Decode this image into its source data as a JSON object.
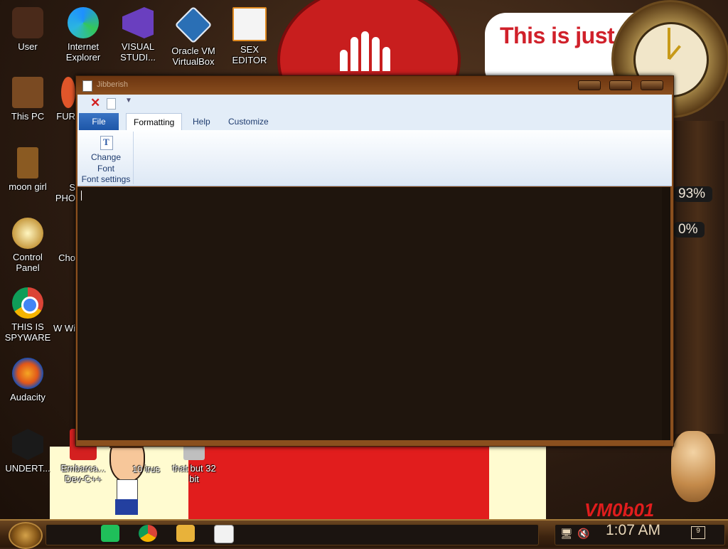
{
  "desktop": {
    "icons": [
      {
        "label": "User"
      },
      {
        "label": "Internet Explorer"
      },
      {
        "label": "VISUAL STUDI..."
      },
      {
        "label": "Oracle VM VirtualBox"
      },
      {
        "label": "SEX EDITOR"
      },
      {
        "label": "This PC"
      },
      {
        "label": "FUR"
      },
      {
        "label": "moon girl"
      },
      {
        "label": "S PHO"
      },
      {
        "label": "Control Panel"
      },
      {
        "label": "Cho"
      },
      {
        "label": "THIS IS SPYWARE"
      },
      {
        "label": "W Wi"
      },
      {
        "label": "Audacity"
      },
      {
        "label": "UNDERT..."
      },
      {
        "label": "Embarca... Dev-C++"
      },
      {
        "label": "10 irus"
      },
      {
        "label": "that but 32 bit"
      }
    ],
    "wallpaper_text": "This is just like George Orwell",
    "wallpaper_vm_text": "VM0b01",
    "gauge_1": "93%",
    "gauge_2": "0%"
  },
  "window": {
    "title": "Jibberish",
    "tabs": {
      "file": "File",
      "formatting": "Formatting",
      "help": "Help",
      "customize": "Customize"
    },
    "ribbon": {
      "change_font_line1": "Change",
      "change_font_line2": "Font",
      "group_label": "Font settings"
    },
    "editor_text": ""
  },
  "taskbar": {
    "time": "1:07 AM",
    "notification_count": "9"
  },
  "colors": {
    "file_tab": "#1d56a8",
    "editor_bg": "#1f150d",
    "frame": "#8a4f1e",
    "wallpaper_red": "#e11d1d"
  }
}
